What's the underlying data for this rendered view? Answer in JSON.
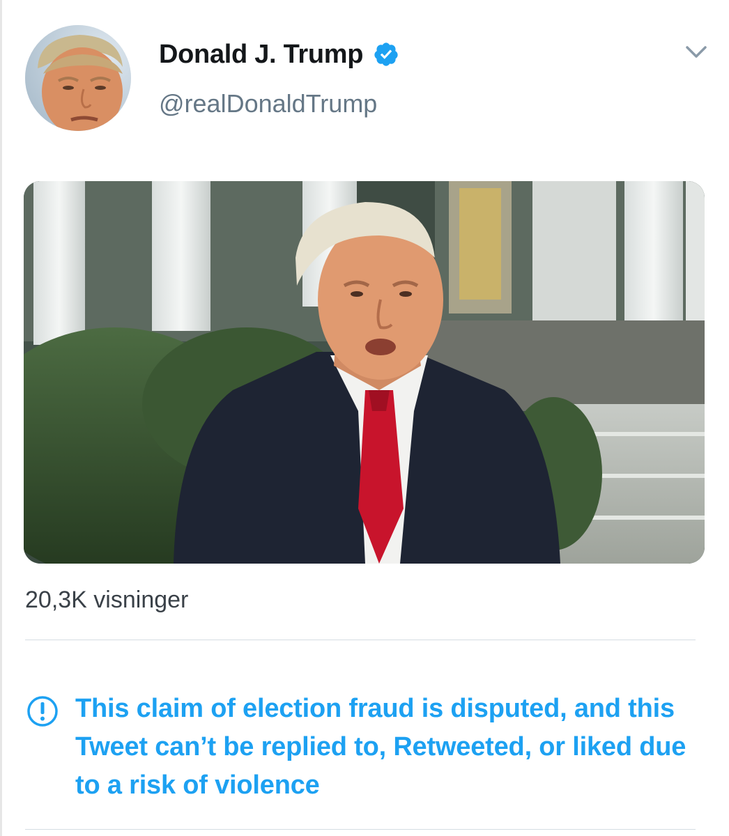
{
  "tweet": {
    "author": {
      "display_name": "Donald J. Trump",
      "handle": "@realDonaldTrump",
      "verified": true,
      "avatar_icon": "profile-photo"
    },
    "media": {
      "type": "video-thumbnail",
      "description_icon": "video-frame"
    },
    "views": "20,3K visninger",
    "notice": {
      "icon": "exclamation-circle-icon",
      "text": "This claim of election fraud is disputed, and this Tweet can’t be replied to, Retweeted, or liked due to a risk of violence"
    },
    "menu_icon": "chevron-down-icon"
  },
  "colors": {
    "accent": "#1da1f2",
    "name_text": "#14171a",
    "handle_text": "#657786",
    "divider": "#d5dde3"
  }
}
